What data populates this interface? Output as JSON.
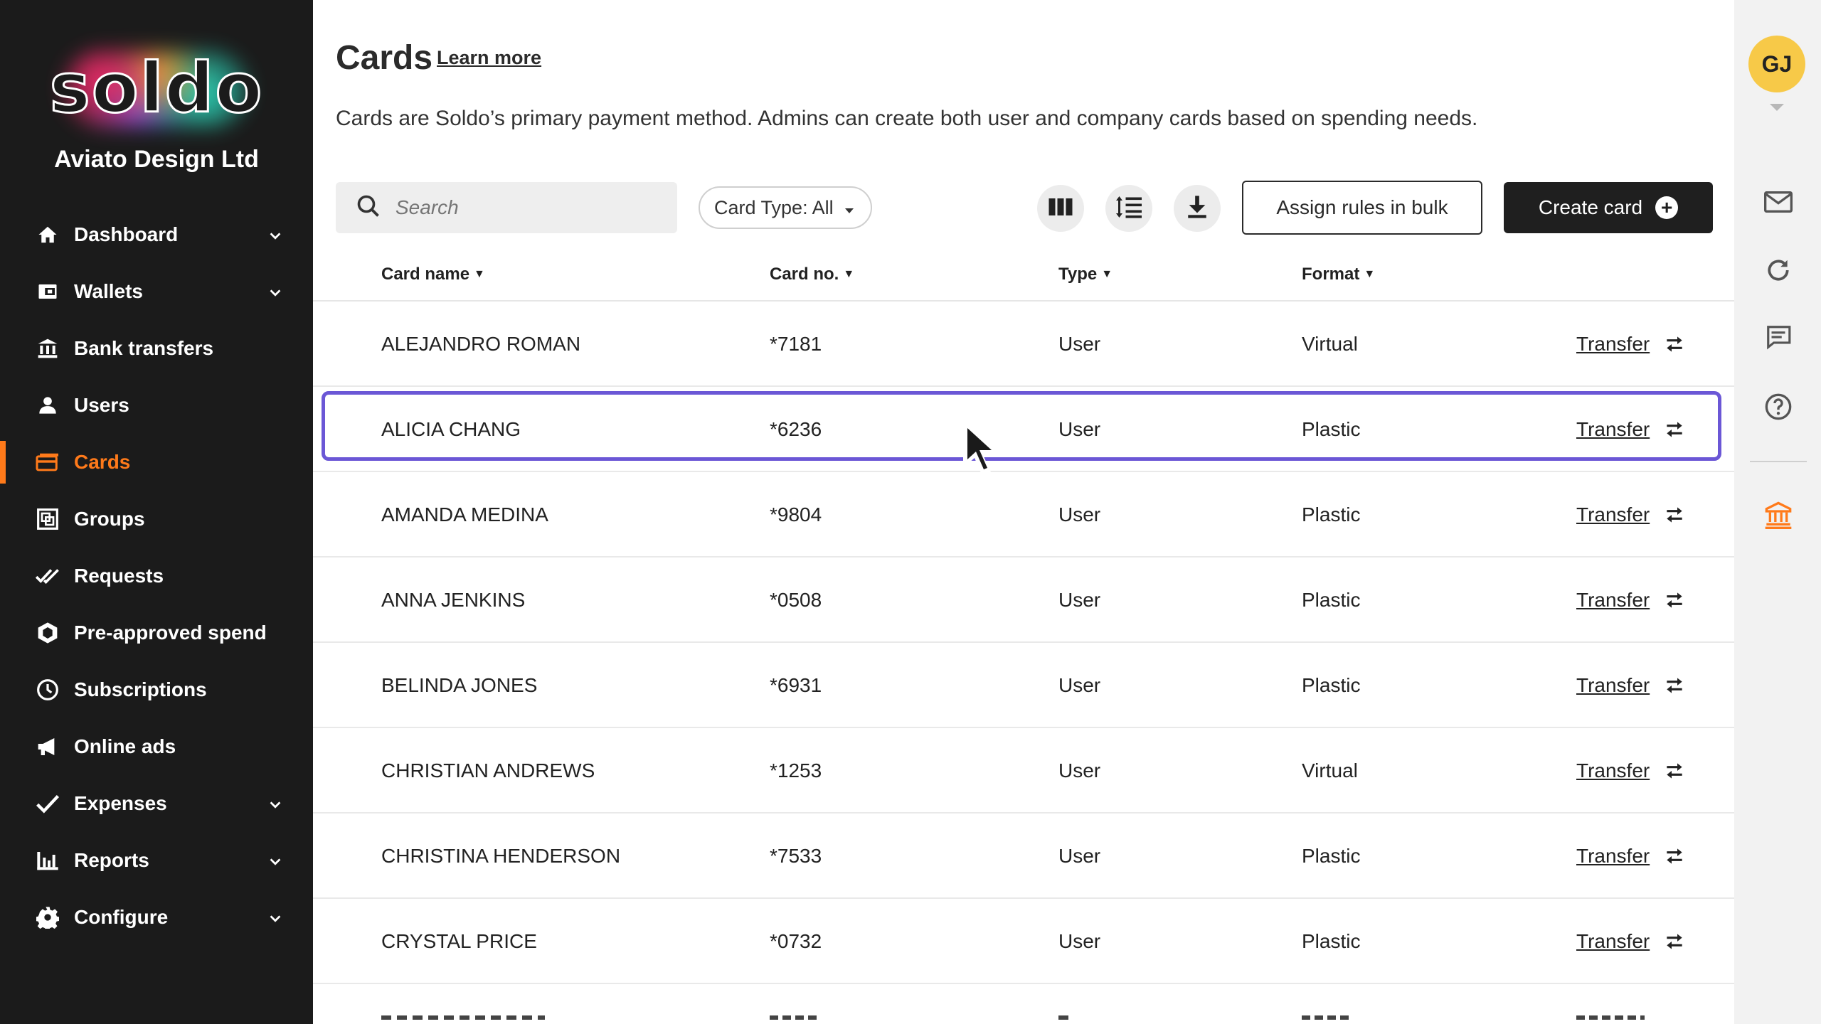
{
  "sidebar": {
    "logo_text": "soldo",
    "company": "Aviato Design Ltd",
    "items": [
      {
        "label": "Dashboard",
        "icon": "home-icon",
        "chevron": true
      },
      {
        "label": "Wallets",
        "icon": "wallet-icon",
        "chevron": true
      },
      {
        "label": "Bank transfers",
        "icon": "bank-transfer-icon",
        "chevron": false
      },
      {
        "label": "Users",
        "icon": "user-icon",
        "chevron": false
      },
      {
        "label": "Cards",
        "icon": "card-icon",
        "chevron": false,
        "active": true
      },
      {
        "label": "Groups",
        "icon": "groups-icon",
        "chevron": false
      },
      {
        "label": "Requests",
        "icon": "check-double-icon",
        "chevron": false
      },
      {
        "label": "Pre-approved spend",
        "icon": "hexagon-icon",
        "chevron": false
      },
      {
        "label": "Subscriptions",
        "icon": "clock-icon",
        "chevron": false
      },
      {
        "label": "Online ads",
        "icon": "megaphone-icon",
        "chevron": false
      },
      {
        "label": "Expenses",
        "icon": "check-icon",
        "chevron": true
      },
      {
        "label": "Reports",
        "icon": "bar-chart-icon",
        "chevron": true
      },
      {
        "label": "Configure",
        "icon": "gear-icon",
        "chevron": true
      }
    ]
  },
  "header": {
    "title": "Cards",
    "learn_more": "Learn more",
    "description": "Cards are Soldo’s primary payment method. Admins can create both user and company cards based on spending needs."
  },
  "toolbar": {
    "search_placeholder": "Search",
    "card_type_filter": "Card Type: All",
    "assign_rules_label": "Assign rules in bulk",
    "create_card_label": "Create card"
  },
  "table": {
    "columns": [
      "Card name",
      "Card no.",
      "Type",
      "Format"
    ],
    "action_label": "Transfer",
    "rows": [
      {
        "name": "ALEJANDRO ROMAN",
        "number": "*7181",
        "type": "User",
        "format": "Virtual"
      },
      {
        "name": "ALICIA CHANG",
        "number": "*6236",
        "type": "User",
        "format": "Plastic",
        "selected": true
      },
      {
        "name": "AMANDA MEDINA",
        "number": "*9804",
        "type": "User",
        "format": "Plastic"
      },
      {
        "name": "ANNA JENKINS",
        "number": "*0508",
        "type": "User",
        "format": "Plastic"
      },
      {
        "name": "BELINDA JONES",
        "number": "*6931",
        "type": "User",
        "format": "Plastic"
      },
      {
        "name": "CHRISTIAN ANDREWS",
        "number": "*1253",
        "type": "User",
        "format": "Virtual"
      },
      {
        "name": "CHRISTINA HENDERSON",
        "number": "*7533",
        "type": "User",
        "format": "Plastic"
      },
      {
        "name": "CRYSTAL PRICE",
        "number": "*0732",
        "type": "User",
        "format": "Plastic"
      }
    ]
  },
  "rail": {
    "avatar_initials": "GJ"
  },
  "colors": {
    "sidebar_bg": "#1b1b1b",
    "accent": "#ff7a1a",
    "selection": "#6b57d6",
    "avatar": "#f7c948"
  }
}
